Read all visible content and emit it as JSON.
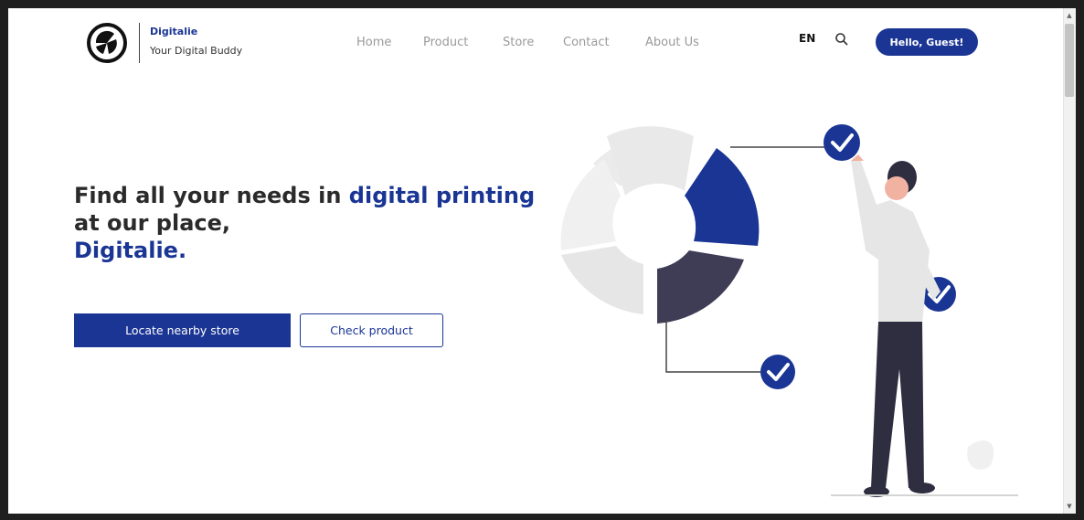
{
  "brand": {
    "name": "Digitalie",
    "tagline": "Your Digital Buddy",
    "logo_icon": "brand-logo-icon"
  },
  "nav": {
    "items": [
      {
        "label": "Home"
      },
      {
        "label": "Product"
      },
      {
        "label": "Store"
      },
      {
        "label": "Contact"
      },
      {
        "label": "About Us"
      }
    ]
  },
  "header": {
    "language": "EN",
    "search_icon": "search-icon",
    "user_button": "Hello, Guest!"
  },
  "hero": {
    "title_part1": "Find all your needs in ",
    "title_accent1": "digital printing",
    "title_part2": "at our place,",
    "title_accent2": "Digitalie.",
    "primary_button": "Locate nearby store",
    "secondary_button": "Check product"
  },
  "colors": {
    "brand_blue": "#1a3594",
    "dark_segment": "#3f3d56",
    "light_gray": "#eeeeee"
  }
}
